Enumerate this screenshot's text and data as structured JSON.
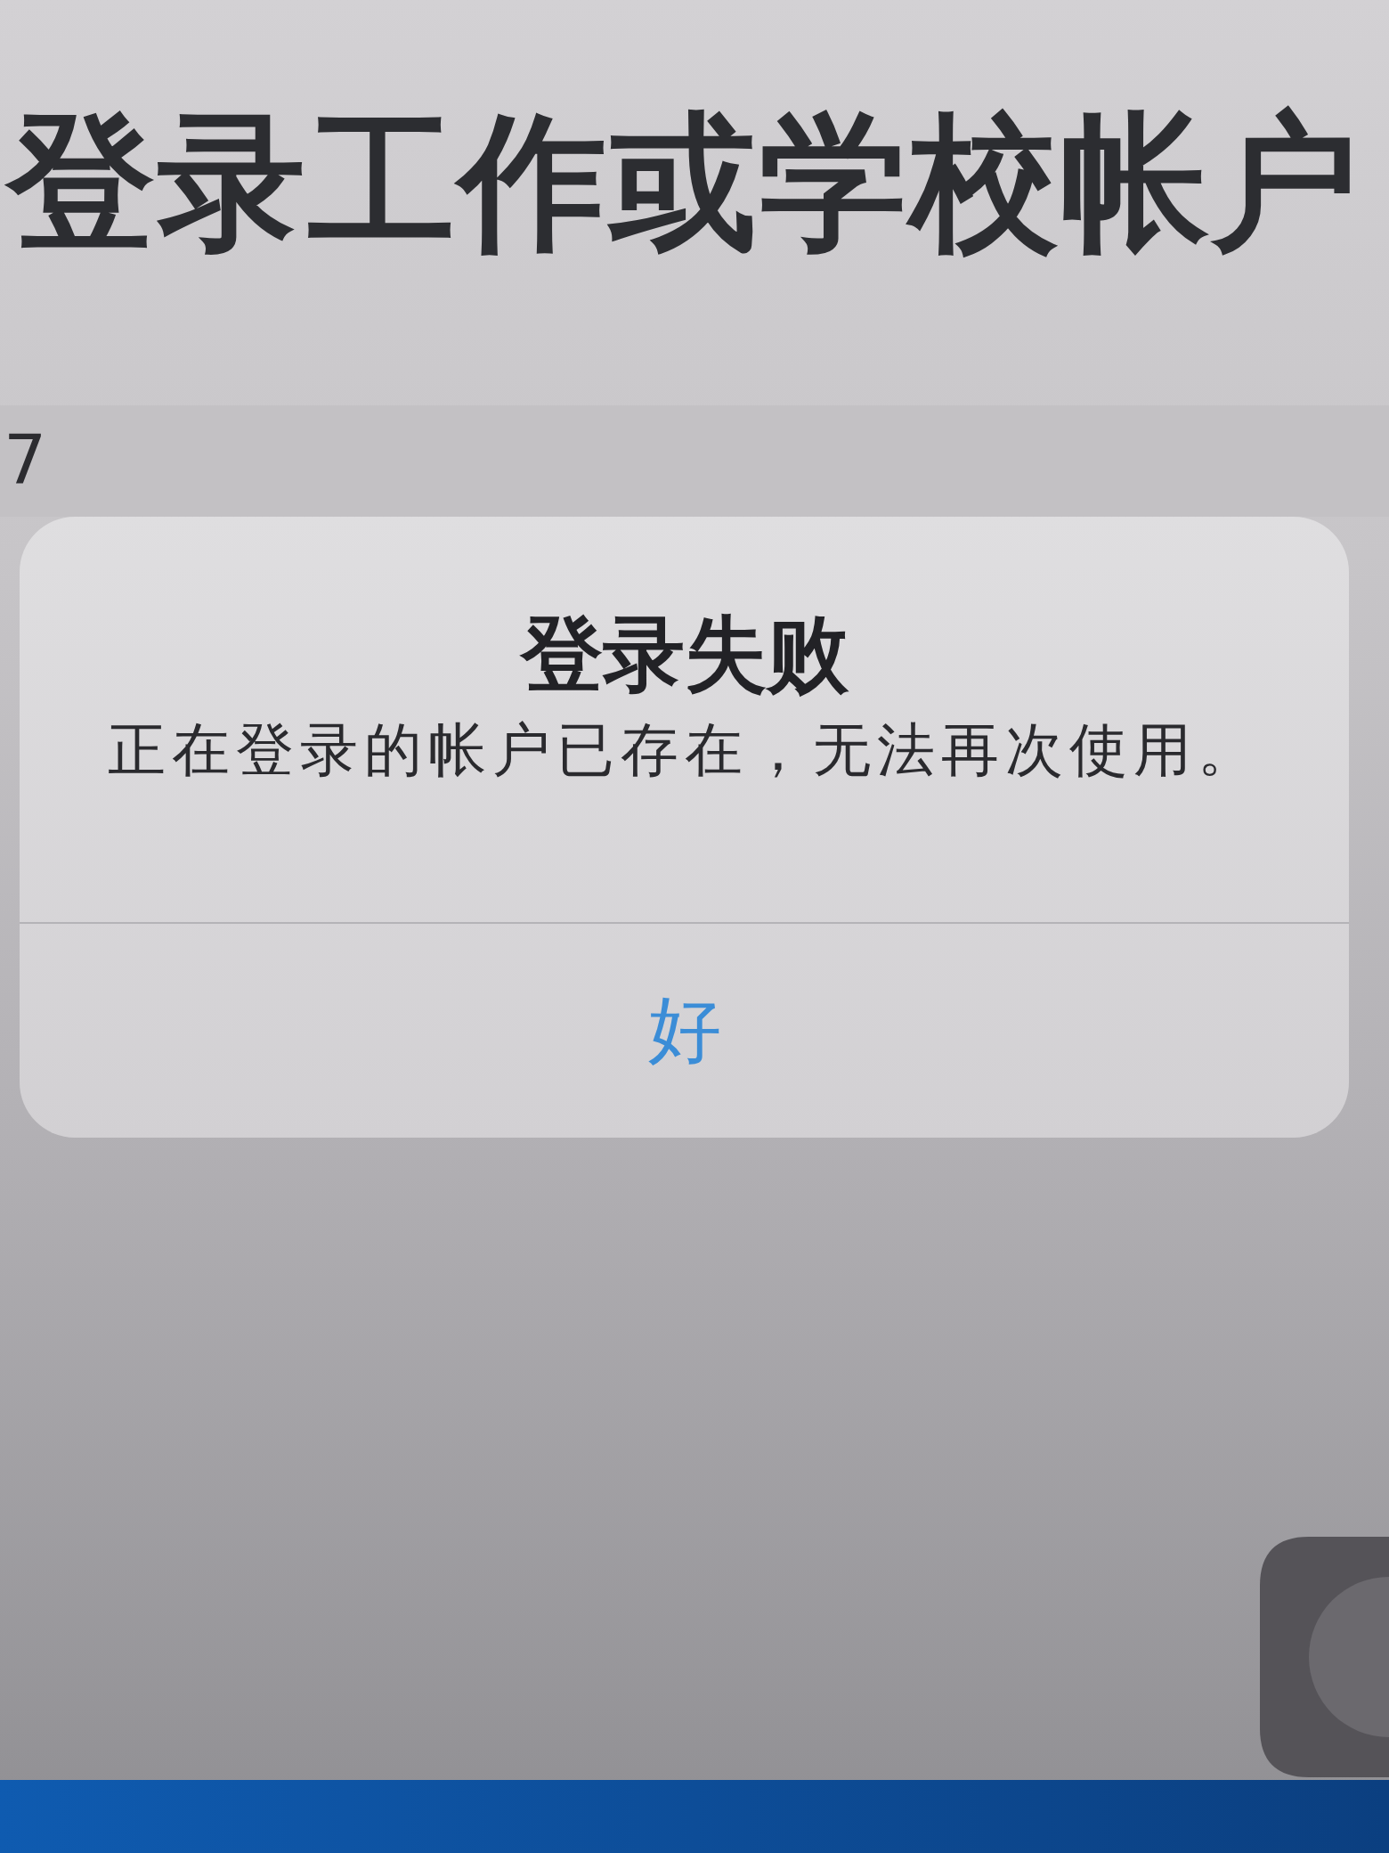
{
  "header": {
    "title": "登录工作或学校帐户"
  },
  "account_field": {
    "value": "7"
  },
  "alert": {
    "title": "登录失败",
    "message": "正在登录的帐户已存在，无法再次使用。",
    "buttons": [
      {
        "label": "好"
      }
    ]
  }
}
